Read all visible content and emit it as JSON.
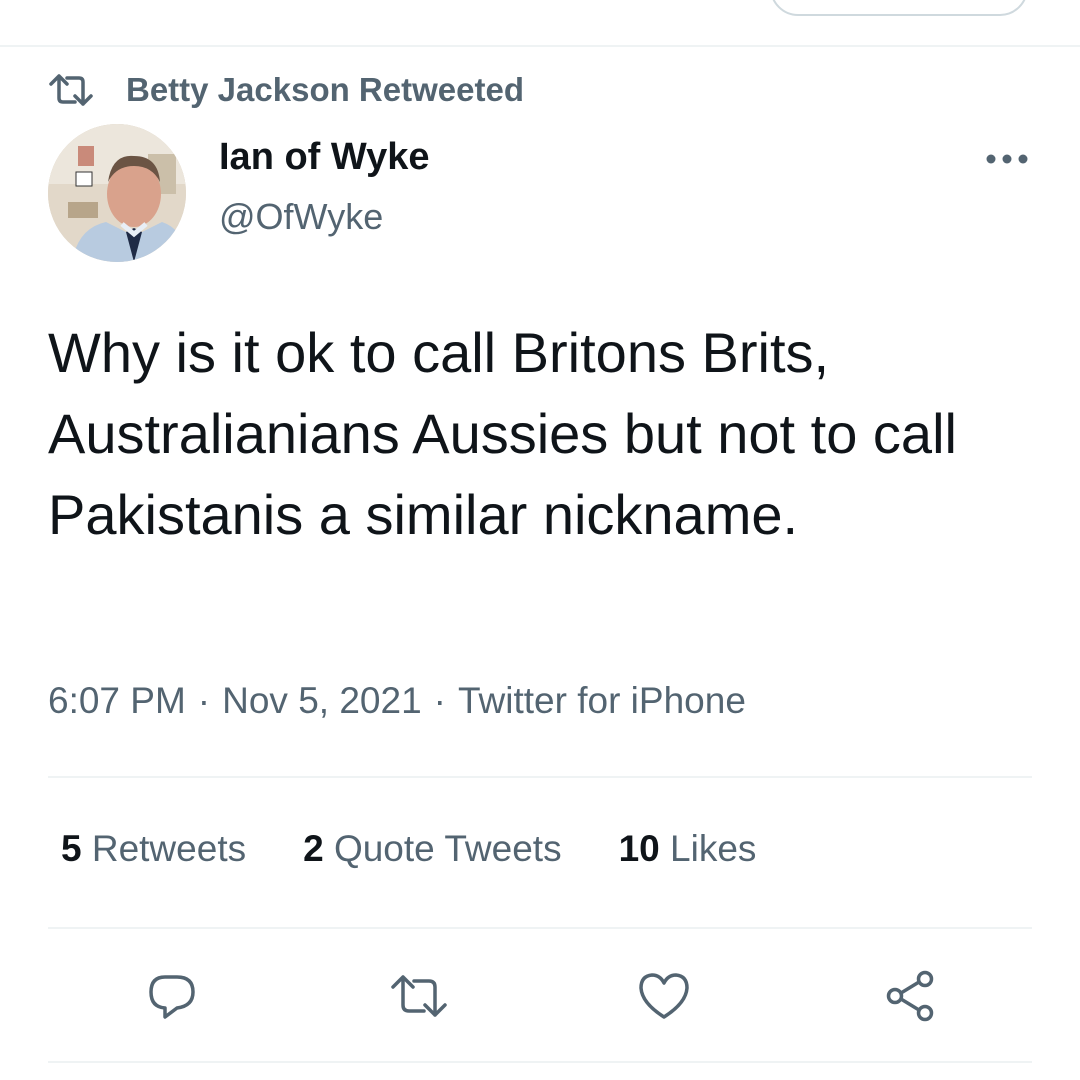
{
  "retweet_banner": {
    "text": "Betty Jackson Retweeted"
  },
  "tweet": {
    "author_name": "Ian of Wyke",
    "author_handle": "@OfWyke",
    "text": "Why is it ok to call Britons Brits, Australianians Aussies but not to call Pakistanis a similar nickname.",
    "time": "6:07 PM",
    "date": "Nov 5, 2021",
    "source": "Twitter for iPhone",
    "separator": "·"
  },
  "stats": {
    "retweets": {
      "count": "5",
      "label": "Retweets"
    },
    "quote_tweets": {
      "count": "2",
      "label": "Quote Tweets"
    },
    "likes": {
      "count": "10",
      "label": "Likes"
    }
  },
  "icons": {
    "retweet_banner": "retweet-icon",
    "more": "more-icon",
    "reply": "reply-icon",
    "retweet": "retweet-icon",
    "like": "heart-icon",
    "share": "share-icon"
  },
  "colors": {
    "secondary_text": "#536471",
    "primary_text": "#0f1419",
    "divider": "#eff3f4"
  }
}
